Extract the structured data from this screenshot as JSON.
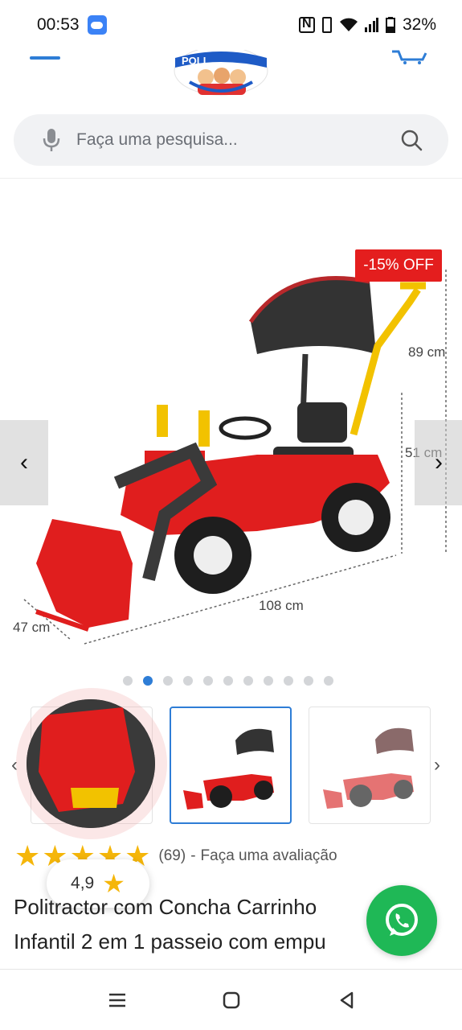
{
  "statusbar": {
    "time": "00:53",
    "battery": "32%",
    "icons": [
      "weather-icon",
      "nfc-icon",
      "vibrate-icon",
      "wifi-icon",
      "signal-icon",
      "battery-icon"
    ]
  },
  "header": {
    "logo_text": "POLI",
    "icons": [
      "menu-icon",
      "cart-icon"
    ]
  },
  "search": {
    "placeholder": "Faça uma pesquisa..."
  },
  "product": {
    "discount": "-15% OFF",
    "dimensions": {
      "height_total": "89 cm",
      "height_seat": "51 cm",
      "length": "108 cm",
      "width": "47 cm"
    },
    "gallery": {
      "total_images": 11,
      "active_index": 1
    },
    "rating": {
      "stars": 5,
      "count": "(69)",
      "separator": "-",
      "review_link": "Faça uma avaliação",
      "score": "4,9"
    },
    "title_line1": "Politractor com Concha Carrinho",
    "title_line2": "Infantil 2 em 1 passeio com empu"
  },
  "colors": {
    "accent": "#2e7dd6",
    "discount": "#e41e1e",
    "star": "#f5b60a",
    "whatsapp": "#1fb856",
    "tractor_red": "#e01e1e"
  }
}
